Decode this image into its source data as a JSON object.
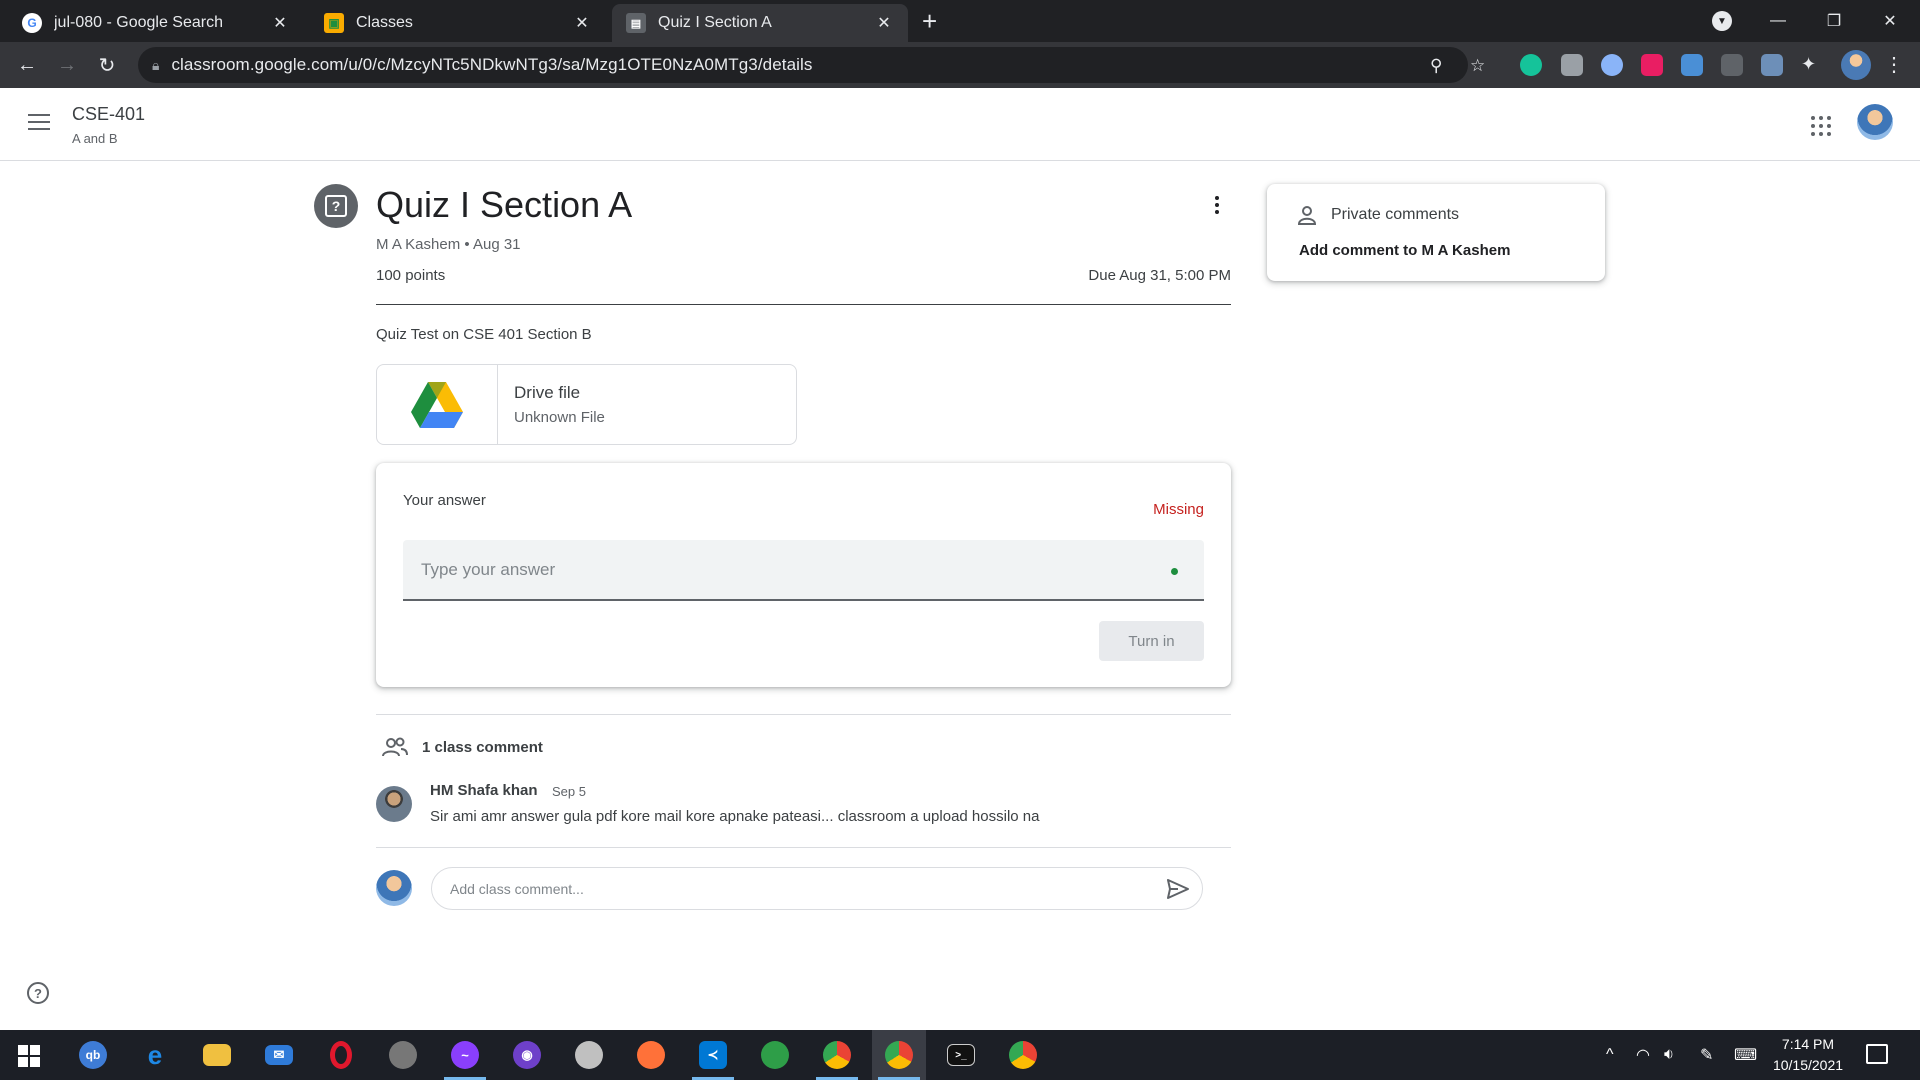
{
  "browser": {
    "tabs": [
      {
        "title": "jul-080 - Google Search",
        "icon": "google-icon"
      },
      {
        "title": "Classes",
        "icon": "classroom-icon"
      },
      {
        "title": "Quiz I Section A",
        "icon": "assignment-icon"
      }
    ],
    "active_tab": 2,
    "url": "classroom.google.com/u/0/c/MzcyNTc5NDkwNTg3/sa/Mzg1OTE0NzA0MTg3/details"
  },
  "header": {
    "class_name": "CSE-401",
    "class_section": "A and B"
  },
  "assignment": {
    "title": "Quiz I Section A",
    "meta": "M A Kashem • Aug 31",
    "points": "100 points",
    "due": "Due Aug 31, 5:00 PM",
    "description": "Quiz Test on CSE 401 Section B",
    "attachment": {
      "name": "Drive file",
      "type": "Unknown File"
    }
  },
  "answer": {
    "label": "Your answer",
    "status": "Missing",
    "placeholder": "Type your answer",
    "turn_in_label": "Turn in"
  },
  "comments": {
    "count_label": "1 class comment",
    "items": [
      {
        "author": "HM Shafa khan",
        "date": "Sep 5",
        "text": "Sir ami amr answer gula pdf kore mail kore apnake pateasi... classroom a upload hossilo na"
      }
    ],
    "add_placeholder": "Add class comment..."
  },
  "private_comments": {
    "title": "Private comments",
    "add_label": "Add comment to M A Kashem"
  },
  "taskbar": {
    "time": "7:14 PM",
    "date": "10/15/2021"
  },
  "colors": {
    "missing": "#c5221f",
    "chrome_bg": "#202124",
    "accent_green": "#1e8e3e"
  }
}
